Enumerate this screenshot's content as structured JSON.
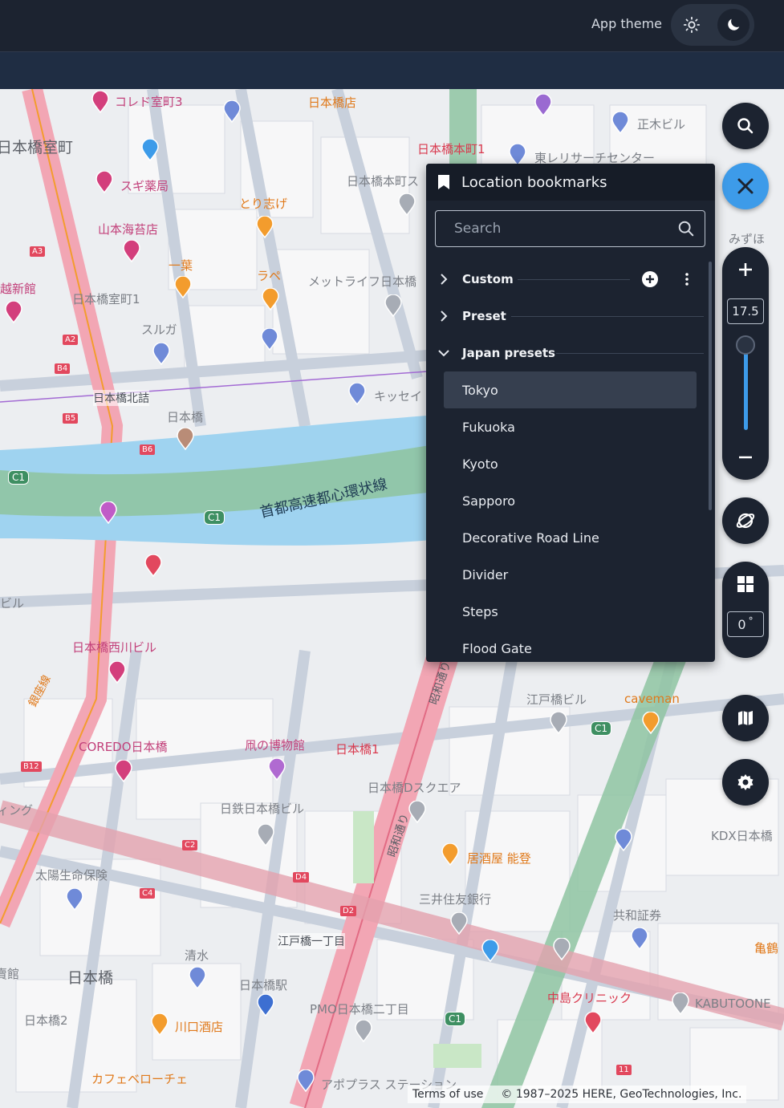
{
  "header": {
    "theme_label": "App theme",
    "theme_options": [
      {
        "icon": "sun-icon",
        "selected": false
      },
      {
        "icon": "moon-icon",
        "selected": true
      }
    ]
  },
  "bookmarks": {
    "title": "Location bookmarks",
    "search_placeholder": "Search",
    "groups": [
      {
        "name": "Custom",
        "expanded": false
      },
      {
        "name": "Preset",
        "expanded": false
      },
      {
        "name": "Japan presets",
        "expanded": true
      }
    ],
    "items": [
      "Tokyo",
      "Fukuoka",
      "Kyoto",
      "Sapporo",
      "Decorative Road Line",
      "Divider",
      "Steps",
      "Flood Gate"
    ],
    "selected_item": "Tokyo"
  },
  "controls": {
    "zoom_level": "17.5",
    "rotation": "0",
    "rotation_unit": "°"
  },
  "map_labels": {
    "highway": "首都高速都心環状線",
    "poi": [
      "コレド室町3",
      "日本橋店",
      "日本橋室町",
      "スギ薬局",
      "山本海苔店",
      "越新館",
      "日本橋室町1",
      "一葉",
      "とり志げ",
      "ラペ",
      "スルガ",
      "メットライフ日本橋",
      "日本橋本町ス",
      "日本橋北詰",
      "日本橋",
      "キッセイ",
      "正木ビル",
      "日本橋本町1",
      "東レリサーチセンター",
      "みずほ",
      "日本橋西川ビル",
      "COREDO日本橋",
      "凧の博物館",
      "日本橋1",
      "日本橋Dスクエア",
      "日鉄日本橋ビル",
      "江戸橋ビル",
      "caveman",
      "KDX日本橋",
      "居酒屋 能登",
      "三井住友銀行",
      "共和証券",
      "太陽生命保険",
      "清水",
      "江戸橋一丁目",
      "日本橋駅",
      "PMO日本橋二丁目",
      "中島クリニック",
      "KABUTOONE",
      "亀鶴",
      "日本橋2",
      "川口酒店",
      "カフェベローチェ",
      "アポプラス ステーション",
      "昭和通り",
      "銀座線",
      "ィング",
      "ビル",
      "賣館"
    ],
    "route_shields": [
      "A3",
      "A2",
      "B4",
      "B5",
      "B6",
      "C1",
      "B12",
      "C2",
      "C4",
      "D4",
      "D2",
      "11"
    ]
  },
  "attribution": {
    "terms": "Terms of use",
    "copyright": "© 1987–2025 HERE, GeoTechnologies, Inc."
  },
  "colors": {
    "accent": "#3d9be9",
    "panel": "#1c2330",
    "header": "#1c2330",
    "subheader": "#1f2d43"
  }
}
